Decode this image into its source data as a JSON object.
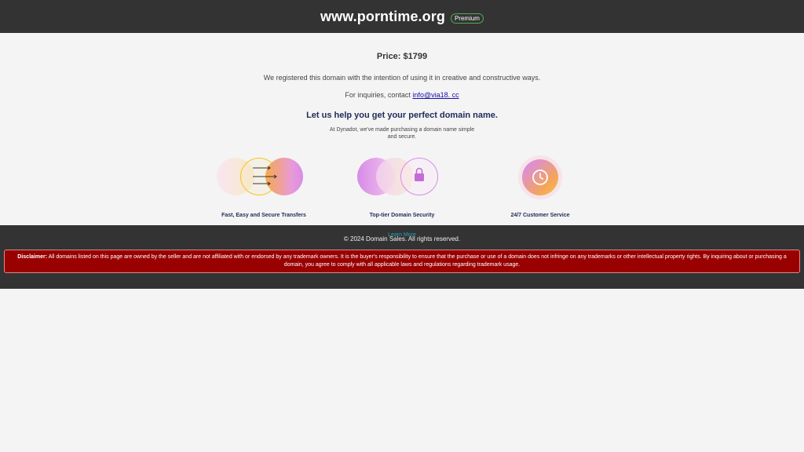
{
  "header": {
    "site_title": "www.porntime.org",
    "badge": "Premium"
  },
  "main": {
    "price": "Price: $1799",
    "intent": "We registered this domain with the intention of using it in creative and constructive ways.",
    "contact_prefix": "For inquiries, contact ",
    "contact_email": "info@via18. cc",
    "headline": "Let us help you get your perfect domain name.",
    "subtext": "At Dynadot, we've made purchasing a domain name simple and secure.",
    "features": [
      {
        "label": "Fast, Easy and Secure Transfers",
        "icon": "arrows-transfer-icon"
      },
      {
        "label": "Top-tier Domain Security",
        "icon": "lock-icon"
      },
      {
        "label": "24/7 Customer Service",
        "icon": "clock-icon"
      }
    ],
    "learn_more": "Learn More"
  },
  "footer": {
    "copyright": "© 2024 Domain Sales. All rights reserved.",
    "disclaimer_label": "Disclaimer:",
    "disclaimer_text": " All domains listed on this page are owned by the seller and are not affiliated with or endorsed by any trademark owners. It is the buyer's responsibility to ensure that the purchase or use of a domain does not infringe on any trademarks or other intellectual property rights. By inquiring about or purchasing a domain, you agree to comply with all applicable laws and regulations regarding trademark usage."
  },
  "colors": {
    "header_bg": "#333333",
    "badge_border": "#4caf50",
    "disclaimer_bg": "#990000",
    "link": "#1a0dab",
    "learn_more": "#2aa1c0",
    "headline": "#1f2b57"
  }
}
